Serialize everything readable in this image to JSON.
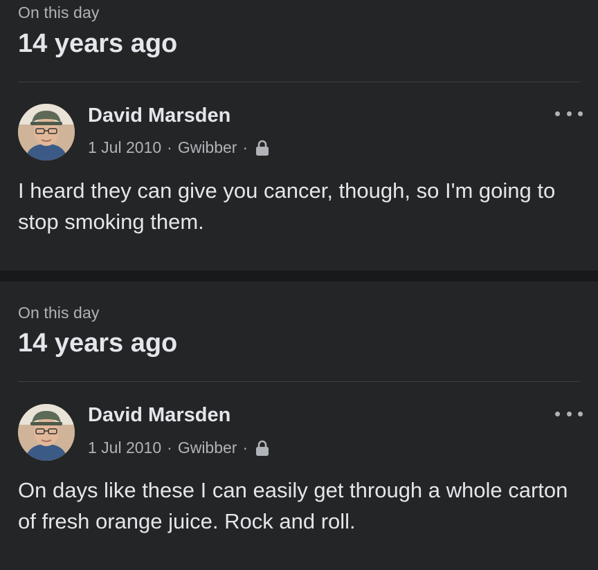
{
  "memories": [
    {
      "heading_small": "On this day",
      "heading_big": "14 years ago",
      "post": {
        "author": "David Marsden",
        "date": "1 Jul 2010",
        "source": "Gwibber",
        "separator": "·",
        "privacy_icon": "lock-icon",
        "text": "I heard they can give you cancer, though, so I'm going to stop smoking them."
      }
    },
    {
      "heading_small": "On this day",
      "heading_big": "14 years ago",
      "post": {
        "author": "David Marsden",
        "date": "1 Jul 2010",
        "source": "Gwibber",
        "separator": "·",
        "privacy_icon": "lock-icon",
        "text": "On days like these I can easily get through a whole carton of fresh orange juice. Rock and roll."
      }
    }
  ],
  "colors": {
    "background": "#18191a",
    "card": "#242526",
    "primary_text": "#e4e6eb",
    "secondary_text": "#b0b3b8",
    "divider": "#3e4042"
  }
}
